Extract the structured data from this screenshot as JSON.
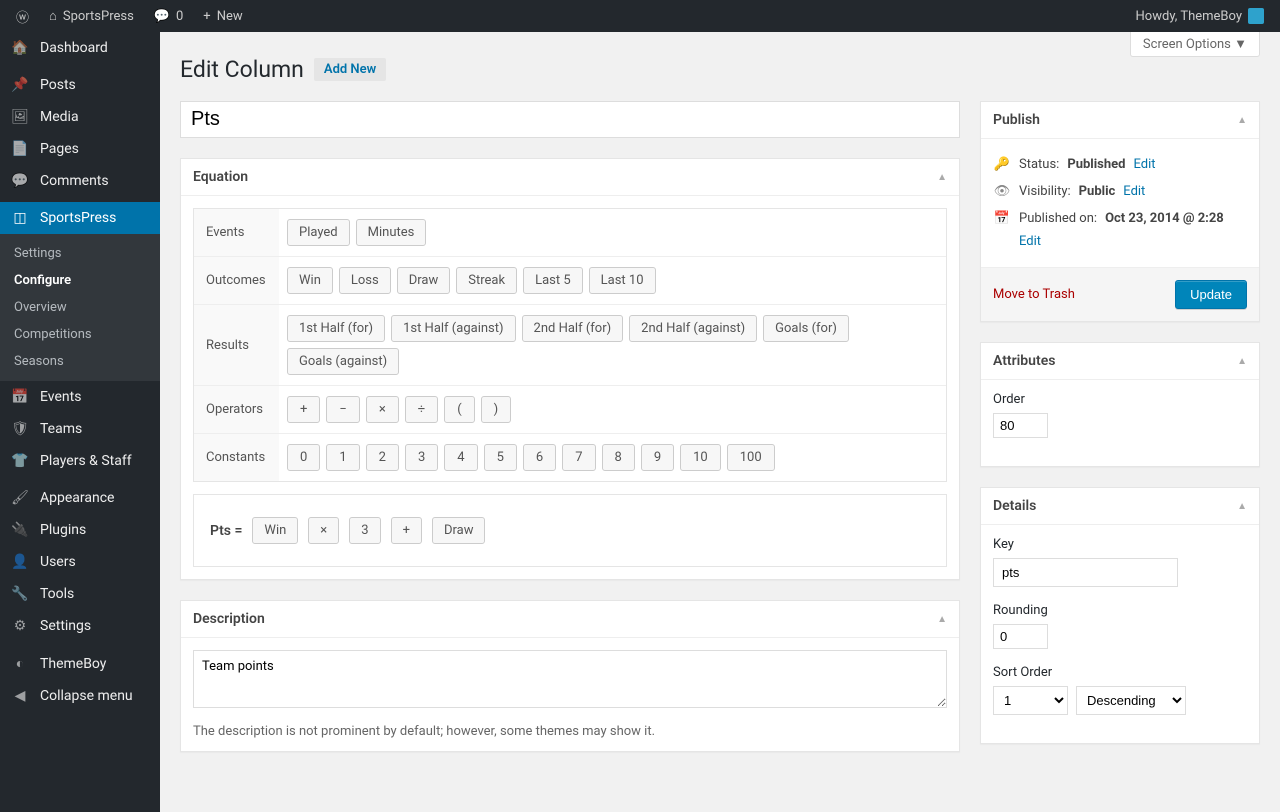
{
  "adminbar": {
    "site": "SportsPress",
    "comments": "0",
    "new": "New",
    "howdy": "Howdy, ThemeBoy"
  },
  "sidebar": {
    "dashboard": "Dashboard",
    "posts": "Posts",
    "media": "Media",
    "pages": "Pages",
    "comments": "Comments",
    "sportspress": "SportsPress",
    "sub": {
      "settings": "Settings",
      "configure": "Configure",
      "overview": "Overview",
      "competitions": "Competitions",
      "seasons": "Seasons"
    },
    "events": "Events",
    "teams": "Teams",
    "players_staff": "Players & Staff",
    "appearance": "Appearance",
    "plugins": "Plugins",
    "users": "Users",
    "tools": "Tools",
    "settings": "Settings",
    "themeboy": "ThemeBoy",
    "collapse": "Collapse menu"
  },
  "screen_options": "Screen Options",
  "page": {
    "title": "Edit Column",
    "add_new": "Add New"
  },
  "title_value": "Pts",
  "equation": {
    "heading": "Equation",
    "rows": {
      "events": {
        "label": "Events",
        "chips": [
          "Played",
          "Minutes"
        ]
      },
      "outcomes": {
        "label": "Outcomes",
        "chips": [
          "Win",
          "Loss",
          "Draw",
          "Streak",
          "Last 5",
          "Last 10"
        ]
      },
      "results": {
        "label": "Results",
        "chips": [
          "1st Half (for)",
          "1st Half (against)",
          "2nd Half (for)",
          "2nd Half (against)",
          "Goals (for)",
          "Goals (against)"
        ]
      },
      "operators": {
        "label": "Operators",
        "chips": [
          "+",
          "−",
          "×",
          "÷",
          "(",
          ")"
        ]
      },
      "constants": {
        "label": "Constants",
        "chips": [
          "0",
          "1",
          "2",
          "3",
          "4",
          "5",
          "6",
          "7",
          "8",
          "9",
          "10",
          "100"
        ]
      }
    },
    "formula": {
      "prefix": "Pts =",
      "tokens": [
        "Win",
        "×",
        "3",
        "+",
        "Draw"
      ]
    }
  },
  "description": {
    "heading": "Description",
    "value": "Team points",
    "help": "The description is not prominent by default; however, some themes may show it."
  },
  "publish": {
    "heading": "Publish",
    "status_label": "Status:",
    "status_value": "Published",
    "visibility_label": "Visibility:",
    "visibility_value": "Public",
    "published_label": "Published on:",
    "published_value": "Oct 23, 2014 @ 2:28",
    "edit": "Edit",
    "trash": "Move to Trash",
    "update": "Update"
  },
  "attributes": {
    "heading": "Attributes",
    "order_label": "Order",
    "order_value": "80"
  },
  "details": {
    "heading": "Details",
    "key_label": "Key",
    "key_value": "pts",
    "rounding_label": "Rounding",
    "rounding_value": "0",
    "sort_label": "Sort Order",
    "sort_num": "1",
    "sort_dir": "Descending"
  }
}
